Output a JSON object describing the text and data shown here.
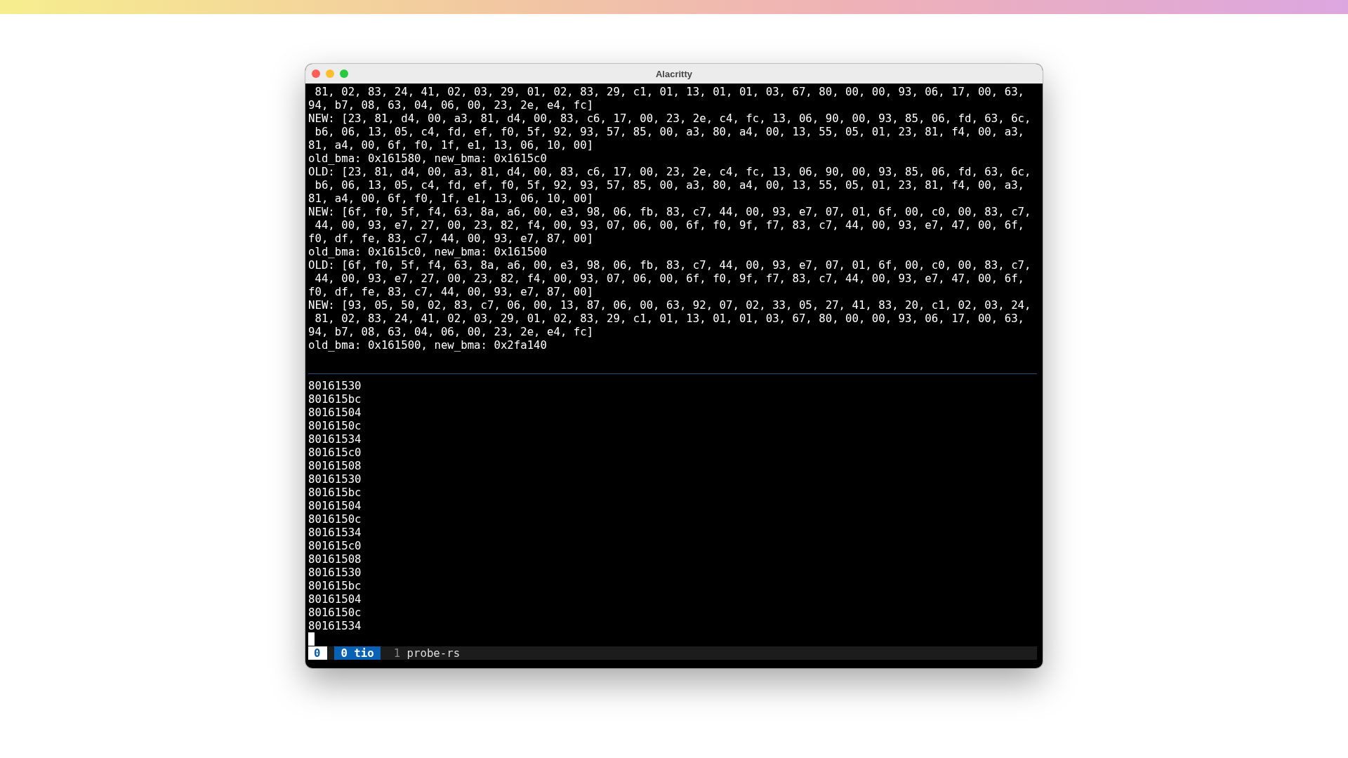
{
  "window": {
    "title": "Alacritty"
  },
  "top_pane": {
    "lines": [
      " 81, 02, 83, 24, 41, 02, 03, 29, 01, 02, 83, 29, c1, 01, 13, 01, 01, 03, 67, 80, 00, 00, 93, 06, 17, 00, 63,",
      "94, b7, 08, 63, 04, 06, 00, 23, 2e, e4, fc]",
      "NEW: [23, 81, d4, 00, a3, 81, d4, 00, 83, c6, 17, 00, 23, 2e, c4, fc, 13, 06, 90, 00, 93, 85, 06, fd, 63, 6c,",
      " b6, 06, 13, 05, c4, fd, ef, f0, 5f, 92, 93, 57, 85, 00, a3, 80, a4, 00, 13, 55, 05, 01, 23, 81, f4, 00, a3,",
      "81, a4, 00, 6f, f0, 1f, e1, 13, 06, 10, 00]",
      "old_bma: 0x161580, new_bma: 0x1615c0",
      "OLD: [23, 81, d4, 00, a3, 81, d4, 00, 83, c6, 17, 00, 23, 2e, c4, fc, 13, 06, 90, 00, 93, 85, 06, fd, 63, 6c,",
      " b6, 06, 13, 05, c4, fd, ef, f0, 5f, 92, 93, 57, 85, 00, a3, 80, a4, 00, 13, 55, 05, 01, 23, 81, f4, 00, a3,",
      "81, a4, 00, 6f, f0, 1f, e1, 13, 06, 10, 00]",
      "NEW: [6f, f0, 5f, f4, 63, 8a, a6, 00, e3, 98, 06, fb, 83, c7, 44, 00, 93, e7, 07, 01, 6f, 00, c0, 00, 83, c7,",
      " 44, 00, 93, e7, 27, 00, 23, 82, f4, 00, 93, 07, 06, 00, 6f, f0, 9f, f7, 83, c7, 44, 00, 93, e7, 47, 00, 6f,",
      "f0, df, fe, 83, c7, 44, 00, 93, e7, 87, 00]",
      "old_bma: 0x1615c0, new_bma: 0x161500",
      "OLD: [6f, f0, 5f, f4, 63, 8a, a6, 00, e3, 98, 06, fb, 83, c7, 44, 00, 93, e7, 07, 01, 6f, 00, c0, 00, 83, c7,",
      " 44, 00, 93, e7, 27, 00, 23, 82, f4, 00, 93, 07, 06, 00, 6f, f0, 9f, f7, 83, c7, 44, 00, 93, e7, 47, 00, 6f,",
      "f0, df, fe, 83, c7, 44, 00, 93, e7, 87, 00]",
      "NEW: [93, 05, 50, 02, 83, c7, 06, 00, 13, 87, 06, 00, 63, 92, 07, 02, 33, 05, 27, 41, 83, 20, c1, 02, 03, 24,",
      " 81, 02, 83, 24, 41, 02, 03, 29, 01, 02, 83, 29, c1, 01, 13, 01, 01, 03, 67, 80, 00, 00, 93, 06, 17, 00, 63,",
      "94, b7, 08, 63, 04, 06, 00, 23, 2e, e4, fc]",
      "old_bma: 0x161500, new_bma: 0x2fa140"
    ]
  },
  "bottom_pane": {
    "lines": [
      "80161530",
      "801615bc",
      "80161504",
      "8016150c",
      "80161534",
      "801615c0",
      "80161508",
      "80161530",
      "801615bc",
      "80161504",
      "8016150c",
      "80161534",
      "801615c0",
      "80161508",
      "80161530",
      "801615bc",
      "80161504",
      "8016150c",
      "80161534"
    ]
  },
  "status_bar": {
    "session": "0",
    "windows": [
      {
        "index": "0",
        "name": "tio",
        "selected": true
      },
      {
        "index": "1",
        "name": "probe-rs",
        "selected": false
      }
    ]
  }
}
